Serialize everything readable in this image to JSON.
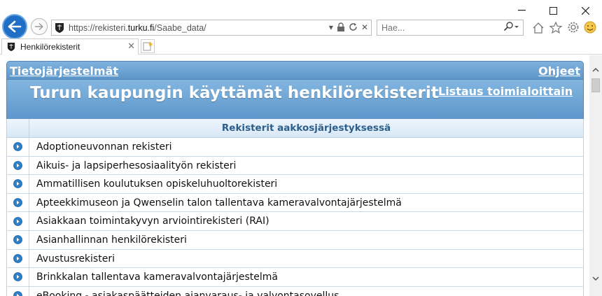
{
  "browser": {
    "url_prefix": "https://rekisteri.",
    "url_domain": "turku.fi",
    "url_path": "/Saabe_data/",
    "search_placeholder": "Hae...",
    "tab_title": "Henkilörekisterit"
  },
  "nav": {
    "left_link": "Tietojärjestelmät",
    "right_link": "Ohjeet"
  },
  "header": {
    "title": "Turun kaupungin käyttämät henkilörekisterit",
    "link": "Listaus toimialoittain"
  },
  "table": {
    "heading": "Rekisterit aakkosjärjestyksessä",
    "rows": [
      "Adoptioneuvonnan rekisteri",
      "Aikuis- ja lapsiperhesosiaalityön rekisteri",
      "Ammatillisen koulutuksen opiskeluhuoltorekisteri",
      "Apteekkimuseon ja Qwenselin talon tallentava kameravalvontajärjestelmä",
      "Asiakkaan toimintakyvyn arviointirekisteri (RAI)",
      "Asianhallinnan henkilörekisteri",
      "Avustusrekisteri",
      "Brinkkalan tallentava kameravalvontajärjestelmä",
      "eBooking - asiakaspäätteiden ajanvaraus- ja valvontasovellus"
    ]
  },
  "colors": {
    "header_blue": "#6fa6d6",
    "link_text": "#ffffff",
    "heading_text": "#2b5e8a",
    "bullet": "#2f7fc7"
  }
}
